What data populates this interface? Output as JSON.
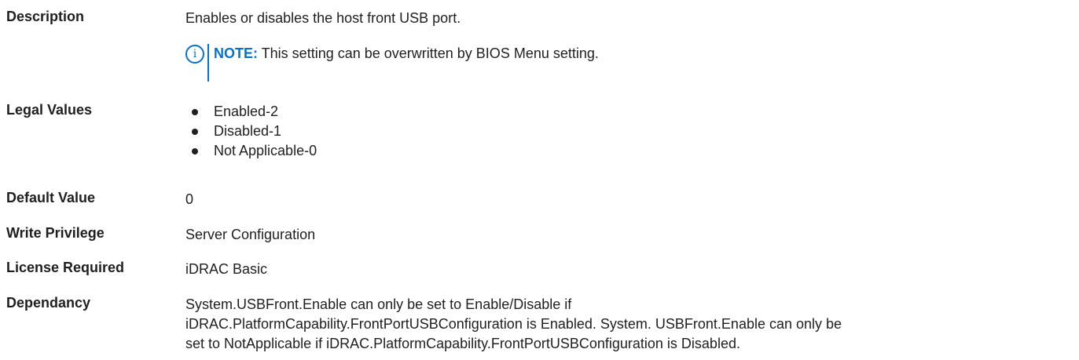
{
  "rows": {
    "description": {
      "label": "Description",
      "value": "Enables or disables the host front USB port."
    },
    "note": {
      "icon": "info-icon",
      "label": "NOTE:",
      "text": " This setting can be overwritten by BIOS Menu setting.",
      "color": "#0672cb"
    },
    "legal_values": {
      "label": "Legal Values",
      "items": [
        "Enabled-2",
        "Disabled-1",
        "Not Applicable-0"
      ]
    },
    "default_value": {
      "label": "Default Value",
      "value": "0"
    },
    "write_privilege": {
      "label": "Write Privilege",
      "value": "Server Configuration"
    },
    "license_required": {
      "label": "License Required",
      "value": "iDRAC Basic"
    },
    "dependancy": {
      "label": "Dependancy",
      "lines": [
        "System.USBFront.Enable can only be set to Enable/Disable if",
        "iDRAC.PlatformCapability.FrontPortUSBConfiguration is Enabled. System. USBFront.Enable can only be",
        "set to NotApplicable if iDRAC.PlatformCapability.FrontPortUSBConfiguration is Disabled."
      ]
    }
  }
}
